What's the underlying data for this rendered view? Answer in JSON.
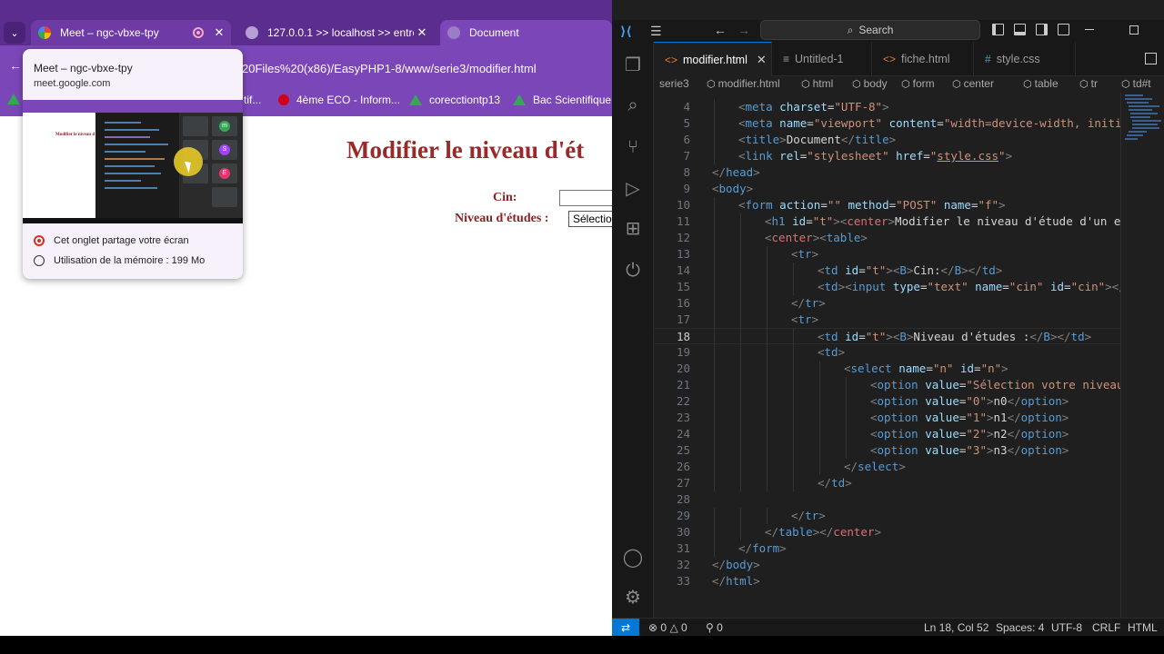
{
  "browser": {
    "tabs": [
      {
        "title": "Meet – ngc-vbxe-tpy",
        "close": "✕"
      },
      {
        "title": "127.0.0.1 >> localhost >> entre",
        "close": "✕"
      },
      {
        "title": "Document"
      }
    ],
    "tab_dropdown": "⌄",
    "url": "20Files%20(x86)/EasyPHP1-8/www/serie3/modifier.html",
    "bookmarks": [
      {
        "label": "tif..."
      },
      {
        "label": "4ème ECO - Inform..."
      },
      {
        "label": "corecctiontp13"
      },
      {
        "label": "Bac Scientifique 20"
      }
    ],
    "page": {
      "heading": "Modifier le niveau d'ét",
      "cin_label": "Cin:",
      "niveau_label": "Niveau d'études :",
      "select_value": "Sélectio"
    },
    "hovercard": {
      "title": "Meet – ngc-vbxe-tpy",
      "url": "meet.google.com",
      "sharing": "Cet onglet partage votre écran",
      "memory": "Utilisation de la mémoire : 199 Mo",
      "preview_heading": "Modifier le niveau d",
      "avatars": [
        "m",
        "S",
        "E"
      ]
    }
  },
  "vscode": {
    "search": "Search",
    "tabs": [
      {
        "label": "modifier.html",
        "icon": "<>",
        "active": true,
        "close": "✕"
      },
      {
        "label": "Untitled-1",
        "icon": "≡",
        "active": false
      },
      {
        "label": "fiche.html",
        "icon": "<>",
        "active": false
      },
      {
        "label": "style.css",
        "icon": "#",
        "active": false
      }
    ],
    "breadcrumb": [
      "serie3",
      "modifier.html",
      "html",
      "body",
      "form",
      "center",
      "table",
      "tr",
      "td#t"
    ],
    "lines": [
      {
        "n": "4",
        "indent": 1,
        "parts": [
          [
            "br",
            "<"
          ],
          [
            "tag",
            "meta"
          ],
          [
            "txt",
            " "
          ],
          [
            "attr",
            "charset"
          ],
          [
            "txt",
            "="
          ],
          [
            "str",
            "\"UTF-8\""
          ],
          [
            "br",
            ">"
          ]
        ]
      },
      {
        "n": "5",
        "indent": 1,
        "parts": [
          [
            "br",
            "<"
          ],
          [
            "tag",
            "meta"
          ],
          [
            "txt",
            " "
          ],
          [
            "attr",
            "name"
          ],
          [
            "txt",
            "="
          ],
          [
            "str",
            "\"viewport\""
          ],
          [
            "txt",
            " "
          ],
          [
            "attr",
            "content"
          ],
          [
            "txt",
            "="
          ],
          [
            "str",
            "\"width=device-width, initial-"
          ]
        ]
      },
      {
        "n": "6",
        "indent": 1,
        "parts": [
          [
            "br",
            "<"
          ],
          [
            "tag",
            "title"
          ],
          [
            "br",
            ">"
          ],
          [
            "txt",
            "Document"
          ],
          [
            "br",
            "</"
          ],
          [
            "tag",
            "title"
          ],
          [
            "br",
            ">"
          ]
        ]
      },
      {
        "n": "7",
        "indent": 1,
        "parts": [
          [
            "br",
            "<"
          ],
          [
            "tag",
            "link"
          ],
          [
            "txt",
            " "
          ],
          [
            "attr",
            "rel"
          ],
          [
            "txt",
            "="
          ],
          [
            "str",
            "\"stylesheet\""
          ],
          [
            "txt",
            " "
          ],
          [
            "attr",
            "href"
          ],
          [
            "txt",
            "="
          ],
          [
            "str",
            "\""
          ],
          [
            "link",
            "style.css"
          ],
          [
            "str",
            "\""
          ],
          [
            "br",
            ">"
          ]
        ]
      },
      {
        "n": "8",
        "indent": 0,
        "parts": [
          [
            "br",
            "</"
          ],
          [
            "tag",
            "head"
          ],
          [
            "br",
            ">"
          ]
        ]
      },
      {
        "n": "9",
        "indent": 0,
        "parts": [
          [
            "br",
            "<"
          ],
          [
            "tag",
            "body"
          ],
          [
            "br",
            ">"
          ]
        ]
      },
      {
        "n": "10",
        "indent": 1,
        "parts": [
          [
            "br",
            "<"
          ],
          [
            "tag",
            "form"
          ],
          [
            "txt",
            " "
          ],
          [
            "attr",
            "action"
          ],
          [
            "txt",
            "="
          ],
          [
            "str",
            "\"\""
          ],
          [
            "txt",
            " "
          ],
          [
            "attr",
            "method"
          ],
          [
            "txt",
            "="
          ],
          [
            "str",
            "\"POST\""
          ],
          [
            "txt",
            " "
          ],
          [
            "attr",
            "name"
          ],
          [
            "txt",
            "="
          ],
          [
            "str",
            "\"f\""
          ],
          [
            "br",
            ">"
          ]
        ]
      },
      {
        "n": "11",
        "indent": 2,
        "parts": [
          [
            "br",
            "<"
          ],
          [
            "tag",
            "h1"
          ],
          [
            "txt",
            " "
          ],
          [
            "attr",
            "id"
          ],
          [
            "txt",
            "="
          ],
          [
            "str",
            "\"t\""
          ],
          [
            "br",
            ">"
          ],
          [
            "br",
            "<"
          ],
          [
            "center",
            "center"
          ],
          [
            "br",
            ">"
          ],
          [
            "txt",
            "Modifier le niveau d'étude d'un empl"
          ]
        ]
      },
      {
        "n": "12",
        "indent": 2,
        "parts": [
          [
            "br",
            "<"
          ],
          [
            "center",
            "center"
          ],
          [
            "br",
            ">"
          ],
          [
            "br",
            "<"
          ],
          [
            "tag",
            "table"
          ],
          [
            "br",
            ">"
          ]
        ]
      },
      {
        "n": "13",
        "indent": 3,
        "parts": [
          [
            "br",
            "<"
          ],
          [
            "tag",
            "tr"
          ],
          [
            "br",
            ">"
          ]
        ]
      },
      {
        "n": "14",
        "indent": 4,
        "parts": [
          [
            "br",
            "<"
          ],
          [
            "tag",
            "td"
          ],
          [
            "txt",
            " "
          ],
          [
            "attr",
            "id"
          ],
          [
            "txt",
            "="
          ],
          [
            "str",
            "\"t\""
          ],
          [
            "br",
            ">"
          ],
          [
            "br",
            "<"
          ],
          [
            "tag",
            "B"
          ],
          [
            "br",
            ">"
          ],
          [
            "txt",
            "Cin:"
          ],
          [
            "br",
            "</"
          ],
          [
            "tag",
            "B"
          ],
          [
            "br",
            ">"
          ],
          [
            "br",
            "</"
          ],
          [
            "tag",
            "td"
          ],
          [
            "br",
            ">"
          ]
        ]
      },
      {
        "n": "15",
        "indent": 4,
        "parts": [
          [
            "br",
            "<"
          ],
          [
            "tag",
            "td"
          ],
          [
            "br",
            ">"
          ],
          [
            "br",
            "<"
          ],
          [
            "tag",
            "input"
          ],
          [
            "txt",
            " "
          ],
          [
            "attr",
            "type"
          ],
          [
            "txt",
            "="
          ],
          [
            "str",
            "\"text\""
          ],
          [
            "txt",
            " "
          ],
          [
            "attr",
            "name"
          ],
          [
            "txt",
            "="
          ],
          [
            "str",
            "\"cin\""
          ],
          [
            "txt",
            " "
          ],
          [
            "attr",
            "id"
          ],
          [
            "txt",
            "="
          ],
          [
            "str",
            "\"cin\""
          ],
          [
            "br",
            ">"
          ],
          [
            "br",
            "</"
          ],
          [
            "tag",
            "td"
          ]
        ]
      },
      {
        "n": "16",
        "indent": 3,
        "parts": [
          [
            "br",
            "</"
          ],
          [
            "tag",
            "tr"
          ],
          [
            "br",
            ">"
          ]
        ]
      },
      {
        "n": "17",
        "indent": 3,
        "parts": [
          [
            "br",
            "<"
          ],
          [
            "tag",
            "tr"
          ],
          [
            "br",
            ">"
          ]
        ]
      },
      {
        "n": "18",
        "indent": 4,
        "parts": [
          [
            "br",
            "<"
          ],
          [
            "tag",
            "td"
          ],
          [
            "txt",
            " "
          ],
          [
            "attr",
            "id"
          ],
          [
            "txt",
            "="
          ],
          [
            "str",
            "\"t\""
          ],
          [
            "br",
            ">"
          ],
          [
            "br",
            "<"
          ],
          [
            "tag",
            "B"
          ],
          [
            "br",
            ">"
          ],
          [
            "txt",
            "Niveau d'études :"
          ],
          [
            "br",
            "</"
          ],
          [
            "tag",
            "B"
          ],
          [
            "br",
            ">"
          ],
          [
            "br",
            "</"
          ],
          [
            "tag",
            "td"
          ],
          [
            "br",
            ">"
          ]
        ]
      },
      {
        "n": "19",
        "indent": 4,
        "parts": [
          [
            "br",
            "<"
          ],
          [
            "tag",
            "td"
          ],
          [
            "br",
            ">"
          ]
        ]
      },
      {
        "n": "20",
        "indent": 5,
        "parts": [
          [
            "br",
            "<"
          ],
          [
            "tag",
            "select"
          ],
          [
            "txt",
            " "
          ],
          [
            "attr",
            "name"
          ],
          [
            "txt",
            "="
          ],
          [
            "str",
            "\"n\""
          ],
          [
            "txt",
            " "
          ],
          [
            "attr",
            "id"
          ],
          [
            "txt",
            "="
          ],
          [
            "str",
            "\"n\""
          ],
          [
            "br",
            ">"
          ]
        ]
      },
      {
        "n": "21",
        "indent": 6,
        "parts": [
          [
            "br",
            "<"
          ],
          [
            "tag",
            "option"
          ],
          [
            "txt",
            " "
          ],
          [
            "attr",
            "value"
          ],
          [
            "txt",
            "="
          ],
          [
            "str",
            "\"Sélection votre niveau\""
          ]
        ]
      },
      {
        "n": "22",
        "indent": 6,
        "parts": [
          [
            "br",
            "<"
          ],
          [
            "tag",
            "option"
          ],
          [
            "txt",
            " "
          ],
          [
            "attr",
            "value"
          ],
          [
            "txt",
            "="
          ],
          [
            "str",
            "\"0\""
          ],
          [
            "br",
            ">"
          ],
          [
            "txt",
            "n0"
          ],
          [
            "br",
            "</"
          ],
          [
            "tag",
            "option"
          ],
          [
            "br",
            ">"
          ]
        ]
      },
      {
        "n": "23",
        "indent": 6,
        "parts": [
          [
            "br",
            "<"
          ],
          [
            "tag",
            "option"
          ],
          [
            "txt",
            " "
          ],
          [
            "attr",
            "value"
          ],
          [
            "txt",
            "="
          ],
          [
            "str",
            "\"1\""
          ],
          [
            "br",
            ">"
          ],
          [
            "txt",
            "n1"
          ],
          [
            "br",
            "</"
          ],
          [
            "tag",
            "option"
          ],
          [
            "br",
            ">"
          ]
        ]
      },
      {
        "n": "24",
        "indent": 6,
        "parts": [
          [
            "br",
            "<"
          ],
          [
            "tag",
            "option"
          ],
          [
            "txt",
            " "
          ],
          [
            "attr",
            "value"
          ],
          [
            "txt",
            "="
          ],
          [
            "str",
            "\"2\""
          ],
          [
            "br",
            ">"
          ],
          [
            "txt",
            "n2"
          ],
          [
            "br",
            "</"
          ],
          [
            "tag",
            "option"
          ],
          [
            "br",
            ">"
          ]
        ]
      },
      {
        "n": "25",
        "indent": 6,
        "parts": [
          [
            "br",
            "<"
          ],
          [
            "tag",
            "option"
          ],
          [
            "txt",
            " "
          ],
          [
            "attr",
            "value"
          ],
          [
            "txt",
            "="
          ],
          [
            "str",
            "\"3\""
          ],
          [
            "br",
            ">"
          ],
          [
            "txt",
            "n3"
          ],
          [
            "br",
            "</"
          ],
          [
            "tag",
            "option"
          ],
          [
            "br",
            ">"
          ]
        ]
      },
      {
        "n": "26",
        "indent": 5,
        "parts": [
          [
            "br",
            "</"
          ],
          [
            "tag",
            "select"
          ],
          [
            "br",
            ">"
          ]
        ]
      },
      {
        "n": "27",
        "indent": 4,
        "parts": [
          [
            "br",
            "</"
          ],
          [
            "tag",
            "td"
          ],
          [
            "br",
            ">"
          ]
        ]
      },
      {
        "n": "28",
        "indent": 0,
        "parts": []
      },
      {
        "n": "29",
        "indent": 3,
        "parts": [
          [
            "br",
            "</"
          ],
          [
            "tag",
            "tr"
          ],
          [
            "br",
            ">"
          ]
        ]
      },
      {
        "n": "30",
        "indent": 2,
        "parts": [
          [
            "br",
            "</"
          ],
          [
            "tag",
            "table"
          ],
          [
            "br",
            ">"
          ],
          [
            "br",
            "</"
          ],
          [
            "center",
            "center"
          ],
          [
            "br",
            ">"
          ]
        ]
      },
      {
        "n": "31",
        "indent": 1,
        "parts": [
          [
            "br",
            "</"
          ],
          [
            "tag",
            "form"
          ],
          [
            "br",
            ">"
          ]
        ]
      },
      {
        "n": "32",
        "indent": 0,
        "parts": [
          [
            "br",
            "</"
          ],
          [
            "tag",
            "body"
          ],
          [
            "br",
            ">"
          ]
        ]
      },
      {
        "n": "33",
        "indent": 0,
        "parts": [
          [
            "br",
            "</"
          ],
          [
            "tag",
            "html"
          ],
          [
            "br",
            ">"
          ]
        ]
      }
    ],
    "current_line": "18",
    "status": {
      "errors": "0",
      "warnings": "0",
      "ports": "0",
      "position": "Ln 18, Col 52",
      "spaces": "Spaces: 4",
      "encoding": "UTF-8",
      "eol": "CRLF",
      "language": "HTML"
    }
  }
}
